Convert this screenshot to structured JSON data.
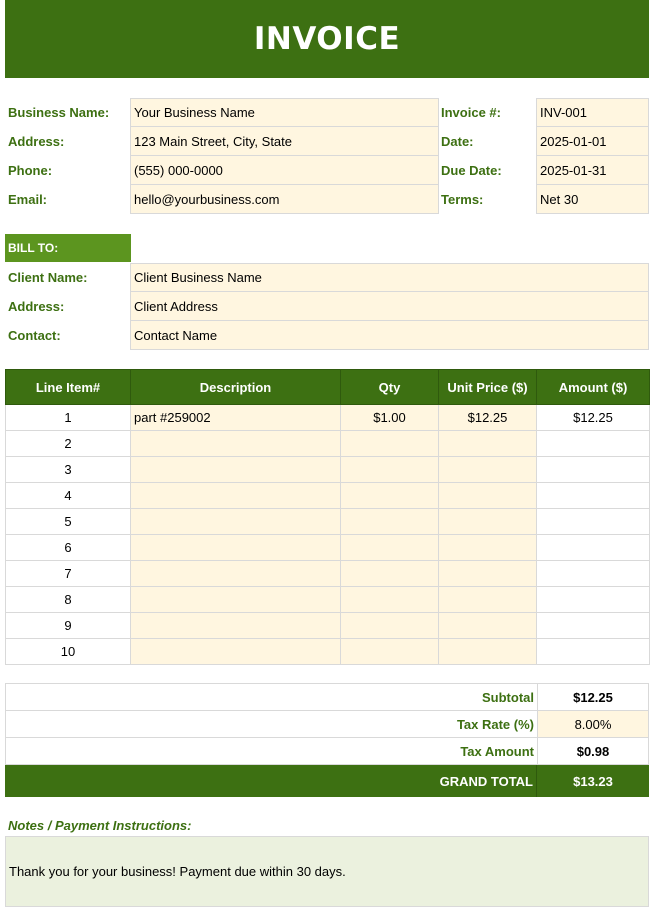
{
  "title": "INVOICE",
  "business": {
    "name_label": "Business Name:",
    "name": "Your Business Name",
    "address_label": "Address:",
    "address": "123 Main Street, City, State",
    "phone_label": "Phone:",
    "phone": "(555) 000-0000",
    "email_label": "Email:",
    "email": "hello@yourbusiness.com"
  },
  "invoice": {
    "number_label": "Invoice #:",
    "number": "INV-001",
    "date_label": "Date:",
    "date": "2025-01-01",
    "due_label": "Due Date:",
    "due": "2025-01-31",
    "terms_label": "Terms:",
    "terms": "Net 30"
  },
  "bill_to": {
    "header": "BILL TO:",
    "client_name_label": "Client Name:",
    "client_name": "Client Business Name",
    "address_label": "Address:",
    "address": "Client Address",
    "contact_label": "Contact:",
    "contact": "Contact Name"
  },
  "items": {
    "headers": [
      "Line Item#",
      "Description",
      "Qty",
      "Unit Price ($)",
      "Amount ($)"
    ],
    "rows": [
      {
        "n": "1",
        "desc": "part #259002",
        "qty": "$1.00",
        "price": "$12.25",
        "amount": "$12.25"
      },
      {
        "n": "2",
        "desc": "",
        "qty": "",
        "price": "",
        "amount": ""
      },
      {
        "n": "3",
        "desc": "",
        "qty": "",
        "price": "",
        "amount": ""
      },
      {
        "n": "4",
        "desc": "",
        "qty": "",
        "price": "",
        "amount": ""
      },
      {
        "n": "5",
        "desc": "",
        "qty": "",
        "price": "",
        "amount": ""
      },
      {
        "n": "6",
        "desc": "",
        "qty": "",
        "price": "",
        "amount": ""
      },
      {
        "n": "7",
        "desc": "",
        "qty": "",
        "price": "",
        "amount": ""
      },
      {
        "n": "8",
        "desc": "",
        "qty": "",
        "price": "",
        "amount": ""
      },
      {
        "n": "9",
        "desc": "",
        "qty": "",
        "price": "",
        "amount": ""
      },
      {
        "n": "10",
        "desc": "",
        "qty": "",
        "price": "",
        "amount": ""
      }
    ]
  },
  "totals": {
    "subtotal_label": "Subtotal",
    "subtotal": "$12.25",
    "tax_rate_label": "Tax Rate (%)",
    "tax_rate": "8.00%",
    "tax_amount_label": "Tax Amount",
    "tax_amount": "$0.98",
    "grand_total_label": "GRAND TOTAL",
    "grand_total": "$13.23"
  },
  "notes": {
    "header": "Notes / Payment Instructions:",
    "text": "Thank you for your business! Payment due within 30 days."
  },
  "colors": {
    "primary": "#3d7012",
    "accent": "#5c951f",
    "input_fill": "#fff6e0",
    "notes_fill": "#ebf1de"
  }
}
